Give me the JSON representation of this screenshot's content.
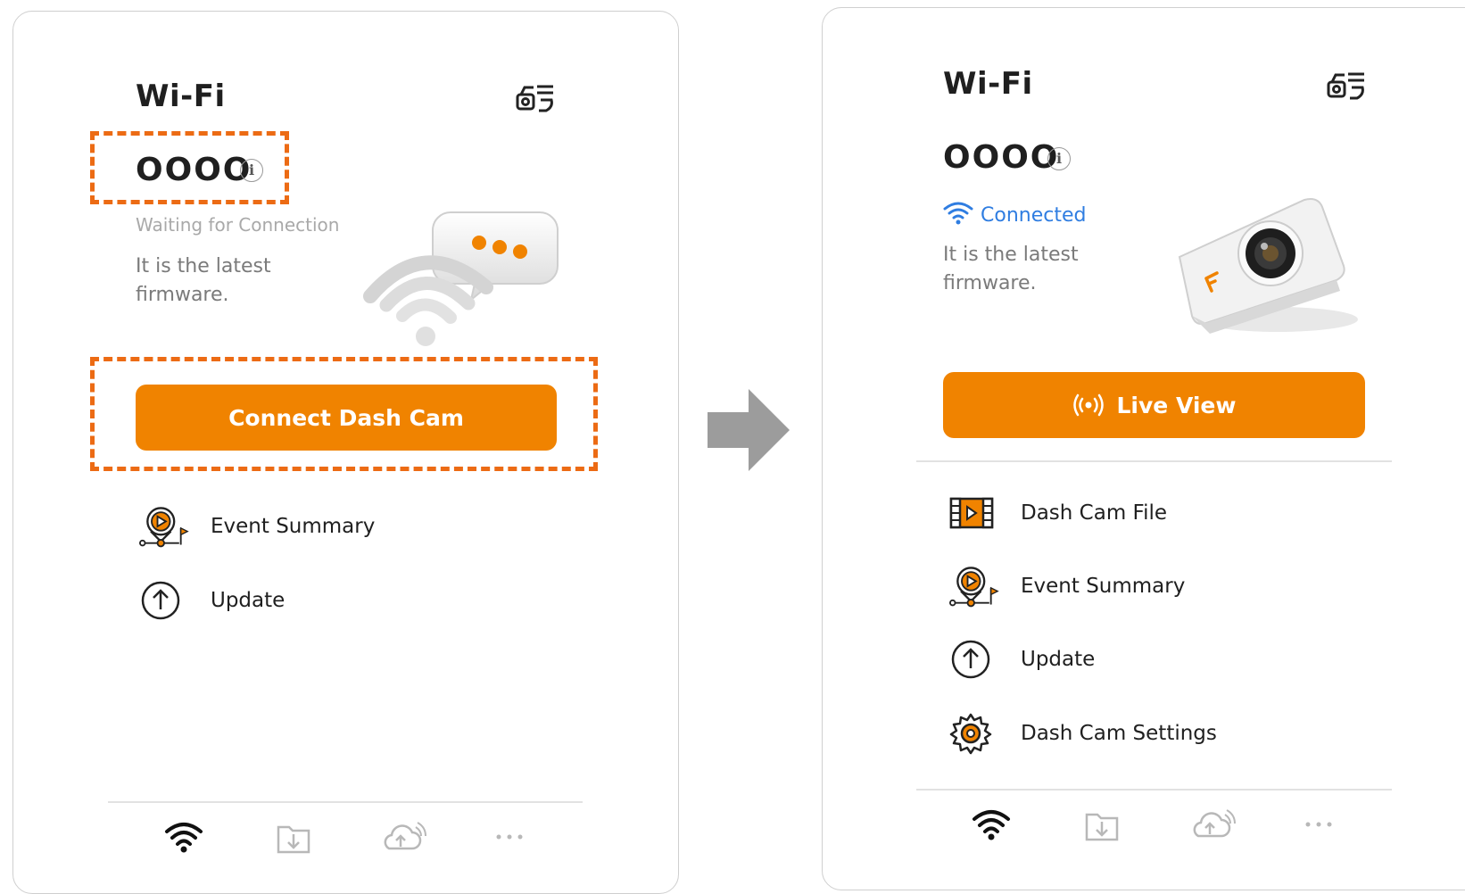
{
  "left": {
    "title": "Wi-Fi",
    "code": "OOOO",
    "status": "Waiting for Connection",
    "firmware_note": "It is the latest firmware.",
    "primary_button": "Connect Dash Cam",
    "menu": [
      {
        "label": "Event Summary",
        "icon": "event-summary-icon"
      },
      {
        "label": "Update",
        "icon": "update-icon"
      }
    ],
    "tabs": [
      "wifi-icon",
      "download-folder-icon",
      "cloud-upload-icon",
      "more-icon"
    ],
    "highlight_color": "#ec6b14"
  },
  "right": {
    "title": "Wi-Fi",
    "code": "OOOO",
    "status": "Connected",
    "firmware_note": "It is the latest firmware.",
    "primary_button": "Live View",
    "menu": [
      {
        "label": "Dash Cam File",
        "icon": "film-icon"
      },
      {
        "label": "Event Summary",
        "icon": "event-summary-icon"
      },
      {
        "label": "Update",
        "icon": "update-icon"
      },
      {
        "label": "Dash Cam Settings",
        "icon": "gear-icon"
      }
    ],
    "tabs": [
      "wifi-icon",
      "download-folder-icon",
      "cloud-upload-icon",
      "more-icon"
    ],
    "status_color": "#2f7de1"
  },
  "accent_color": "#f08300",
  "arrow_color": "#9c9c9c"
}
